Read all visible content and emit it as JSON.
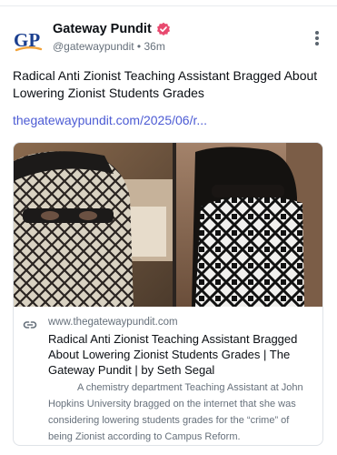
{
  "author": {
    "display_name": "Gateway Pundit",
    "handle": "@gatewaypundit",
    "separator": "•",
    "time_ago": "36m",
    "avatar_text": "GP",
    "verified_icon": "verified-badge-icon",
    "menu_icon": "more-options-icon"
  },
  "post": {
    "text": "Radical Anti Zionist Teaching Assistant Bragged About Lowering Zionist Students Grades",
    "link_text": "thegatewaypundit.com/2025/06/r..."
  },
  "card": {
    "image_alt": "Two masked people wearing keffiyeh scarves",
    "domain_icon": "globe-icon",
    "domain": "www.thegatewaypundit.com",
    "title": "Radical Anti Zionist Teaching Assistant Bragged About Lowering Zionist Students Grades | The Gateway Pundit | by Seth Segal",
    "description": "A chemistry department Teaching Assistant at John Hopkins University bragged on the internet that she was considering lowering students grades for the “crime” of being Zionist according to Campus Reform."
  },
  "colors": {
    "link": "#4c5bd4",
    "verified": "#e84a6f",
    "text_primary": "#0b0f14",
    "text_secondary": "#66707b",
    "brand_blue": "#1b3f8f",
    "brand_orange": "#f2a33a"
  }
}
